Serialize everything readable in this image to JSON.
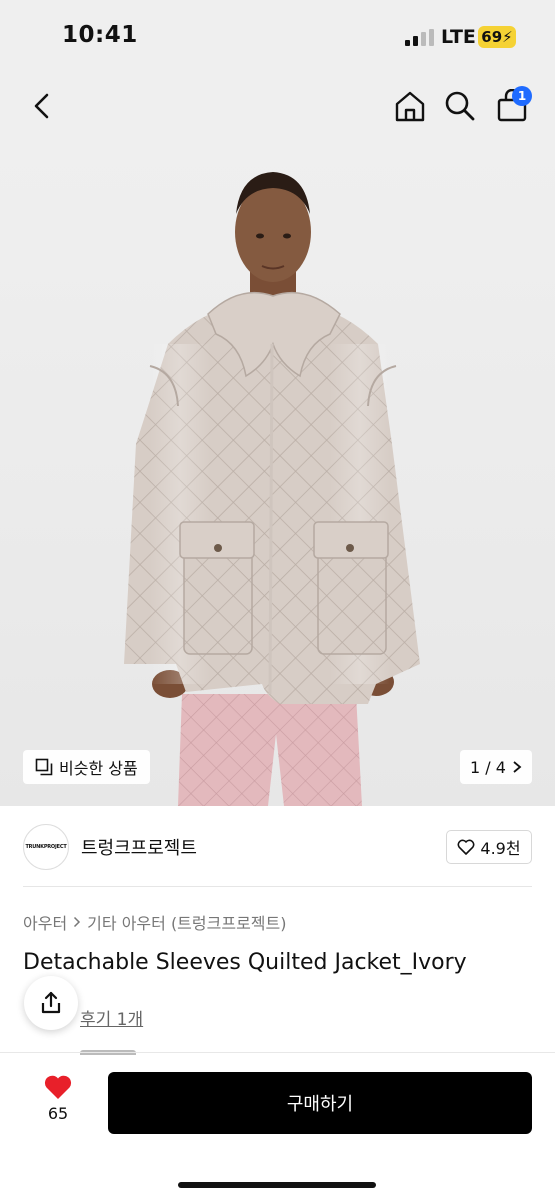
{
  "status": {
    "time": "10:41",
    "network": "LTE",
    "battery": "69"
  },
  "nav": {
    "back_icon": "chevron-left-icon",
    "home_icon": "home-icon",
    "search_icon": "search-icon",
    "bag_icon": "shopping-bag-icon",
    "cart_count": "1"
  },
  "product_image": {
    "similar_label": "비슷한 상품",
    "pager": "1 / 4"
  },
  "seller": {
    "logo_text": "TRUNKPROJECT",
    "name": "트렁크프로젝트",
    "likes": "4.9천"
  },
  "product": {
    "category_1": "아우터",
    "category_2": "기타 아우터 (트렁크프로젝트)",
    "title": "Detachable Sleeves Quilted Jacket_Ivory",
    "review_link": "후기 1개"
  },
  "bottom": {
    "wish_count": "65",
    "buy_label": "구매하기"
  },
  "colors": {
    "accent_blue": "#1f6bff",
    "heart_red": "#e8202a",
    "battery_yellow": "#f5d234",
    "buy_button": "#000000"
  }
}
